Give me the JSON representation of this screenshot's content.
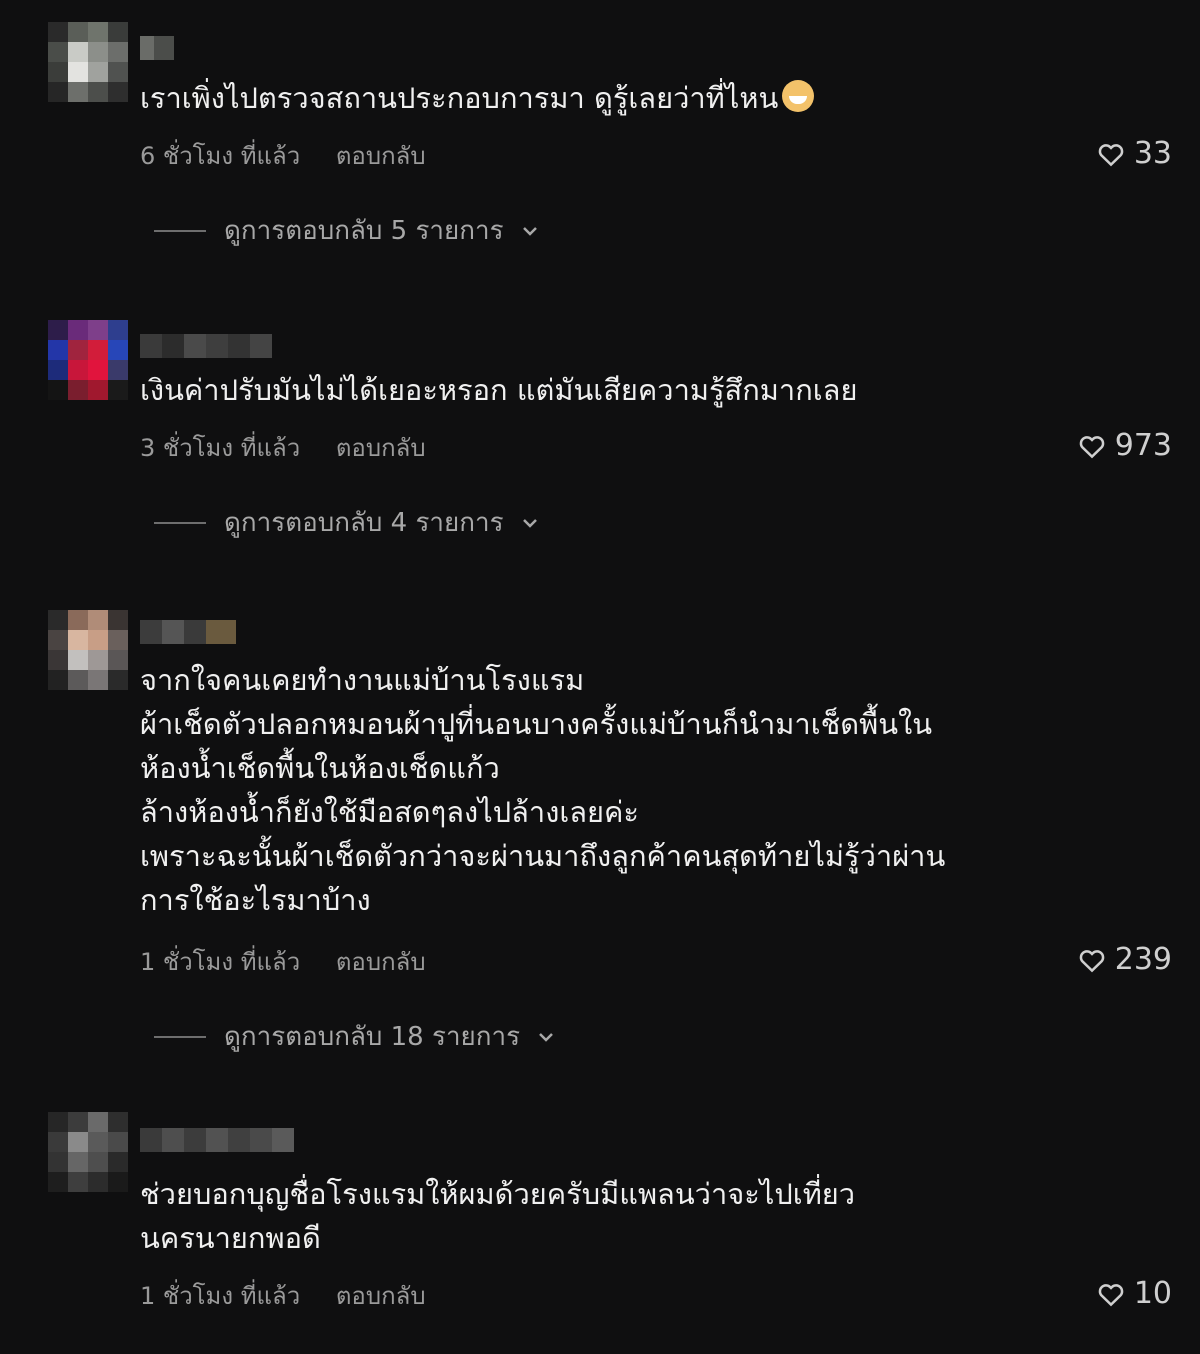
{
  "comments": [
    {
      "text_lines": [
        "เราเพิ่งไปตรวจสถานประกอบการมา ดูรู้เลยว่าที่ไหน"
      ],
      "emoji": "grinning-face-emoji",
      "time": "6 ชั่วโมง ที่แล้ว",
      "reply": "ตอบกลับ",
      "likes": "33",
      "view_replies": "ดูการตอบกลับ 5 รายการ"
    },
    {
      "text_lines": [
        "เงินค่าปรับมันไม่ได้เยอะหรอก แต่มันเสียความรู้สึกมากเลย"
      ],
      "time": "3 ชั่วโมง ที่แล้ว",
      "reply": "ตอบกลับ",
      "likes": "973",
      "view_replies": "ดูการตอบกลับ 4 รายการ"
    },
    {
      "text_lines": [
        "จากใจคนเคยทำงานแม่บ้านโรงแรม",
        "ผ้าเช็ดตัวปลอกหมอนผ้าปูที่นอนบางครั้งแม่บ้านก็นำมาเช็ดพื้นใน",
        "ห้องน้ำเช็ดพื้นในห้องเช็ดแก้ว",
        "ล้างห้องน้ำก็ยังใช้มือสดๆลงไปล้างเลยค่ะ",
        "เพราะฉะนั้นผ้าเช็ดตัวกว่าจะผ่านมาถึงลูกค้าคนสุดท้ายไม่รู้ว่าผ่าน",
        "การใช้อะไรมาบ้าง"
      ],
      "time": "1 ชั่วโมง ที่แล้ว",
      "reply": "ตอบกลับ",
      "likes": "239",
      "view_replies": "ดูการตอบกลับ 18 รายการ"
    },
    {
      "text_lines": [
        "ช่วยบอกบุญชื่อโรงแรมให้ผมด้วยครับมีแพลนว่าจะไปเที่ยว",
        "นครนายกพอดี"
      ],
      "time": "1 ชั่วโมง ที่แล้ว",
      "reply": "ตอบกลับ",
      "likes": "10"
    }
  ]
}
